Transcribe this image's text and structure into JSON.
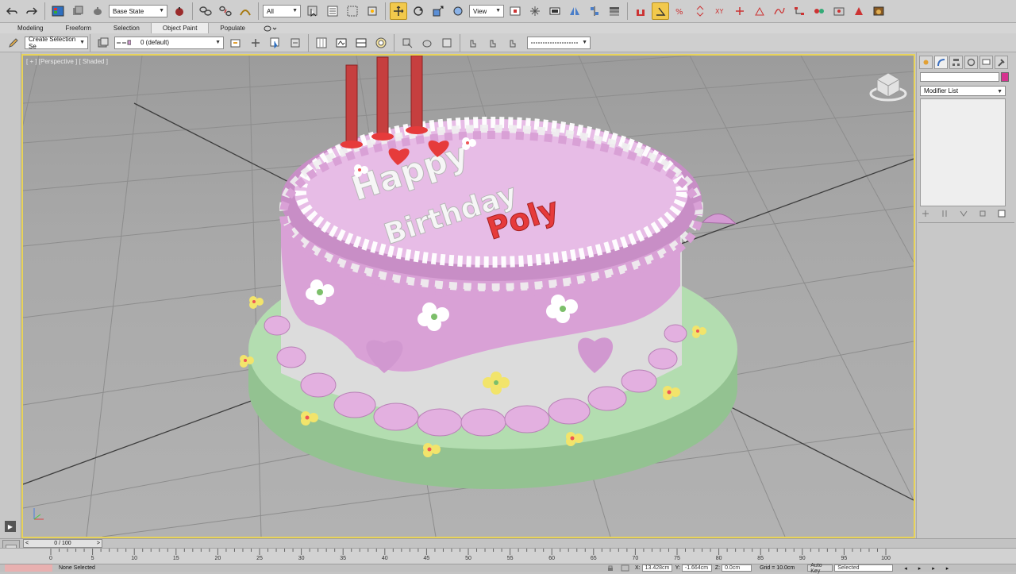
{
  "toolbar": {
    "state_dropdown": "Base State",
    "selection_filter": "All",
    "reference_coord": "View"
  },
  "ribbon": {
    "tabs": [
      "Modeling",
      "Freeform",
      "Selection",
      "Object Paint",
      "Populate"
    ],
    "active_tab": "Object Paint"
  },
  "sec_toolbar": {
    "selection_set": "Create Selection Se",
    "layer": "0 (default)"
  },
  "viewport": {
    "label": "[ + ] [Perspective ] [ Shaded ]",
    "cake_text": {
      "line1": "Happy",
      "line2": "Birthday",
      "line3": "Poly"
    }
  },
  "command_panel": {
    "modifier_list": "Modifier List",
    "name_value": ""
  },
  "timeline": {
    "frame_counter": "0 / 100",
    "ticks": [
      "0",
      "5",
      "10",
      "15",
      "20",
      "25",
      "30",
      "35",
      "40",
      "45",
      "50",
      "55",
      "60",
      "65",
      "70",
      "75",
      "80",
      "85",
      "90",
      "95",
      "100"
    ]
  },
  "status": {
    "message": "None Selected",
    "x_coord": "13.428cm",
    "y_coord": "-1.664cm",
    "z_coord": "0.0cm",
    "grid": "Grid = 10.0cm",
    "auto_key": "Auto Key",
    "key_filter": "Selected"
  },
  "colors": {
    "viewport_border": "#e8d35a",
    "active_tool": "#f2c94c",
    "cake_top": "#d9a6d8",
    "cake_board": "#a9d7a6"
  }
}
